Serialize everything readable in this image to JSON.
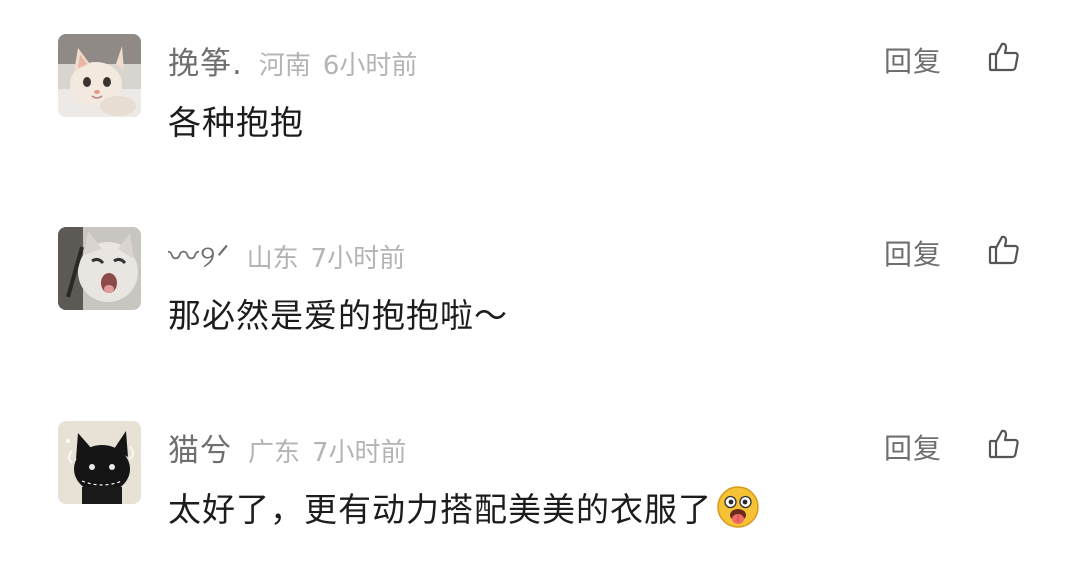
{
  "comments": [
    {
      "avatar_icon": "kitten-avatar-icon",
      "username": "挽筝.",
      "location": "河南",
      "time": "6小时前",
      "text": "各种抱抱",
      "reply_label": "回复",
      "like_icon": "thumbs-up-icon"
    },
    {
      "avatar_icon": "crying-cat-avatar-icon",
      "username": "〰୨ᐟ",
      "location": "山东",
      "time": "7小时前",
      "text": "那必然是爱的抱抱啦～",
      "reply_label": "回复",
      "like_icon": "thumbs-up-icon"
    },
    {
      "avatar_icon": "black-cat-avatar-icon",
      "username": "猫兮",
      "location": "广东",
      "time": "7小时前",
      "text": "太好了，更有动力搭配美美的衣服了",
      "emoji_icon": "tongue-out-emoji-icon",
      "reply_label": "回复",
      "like_icon": "thumbs-up-icon"
    }
  ],
  "colors": {
    "username": "#6f6f6f",
    "meta": "#b4b4b4",
    "text": "#1c1c1c",
    "background": "#ffffff"
  }
}
